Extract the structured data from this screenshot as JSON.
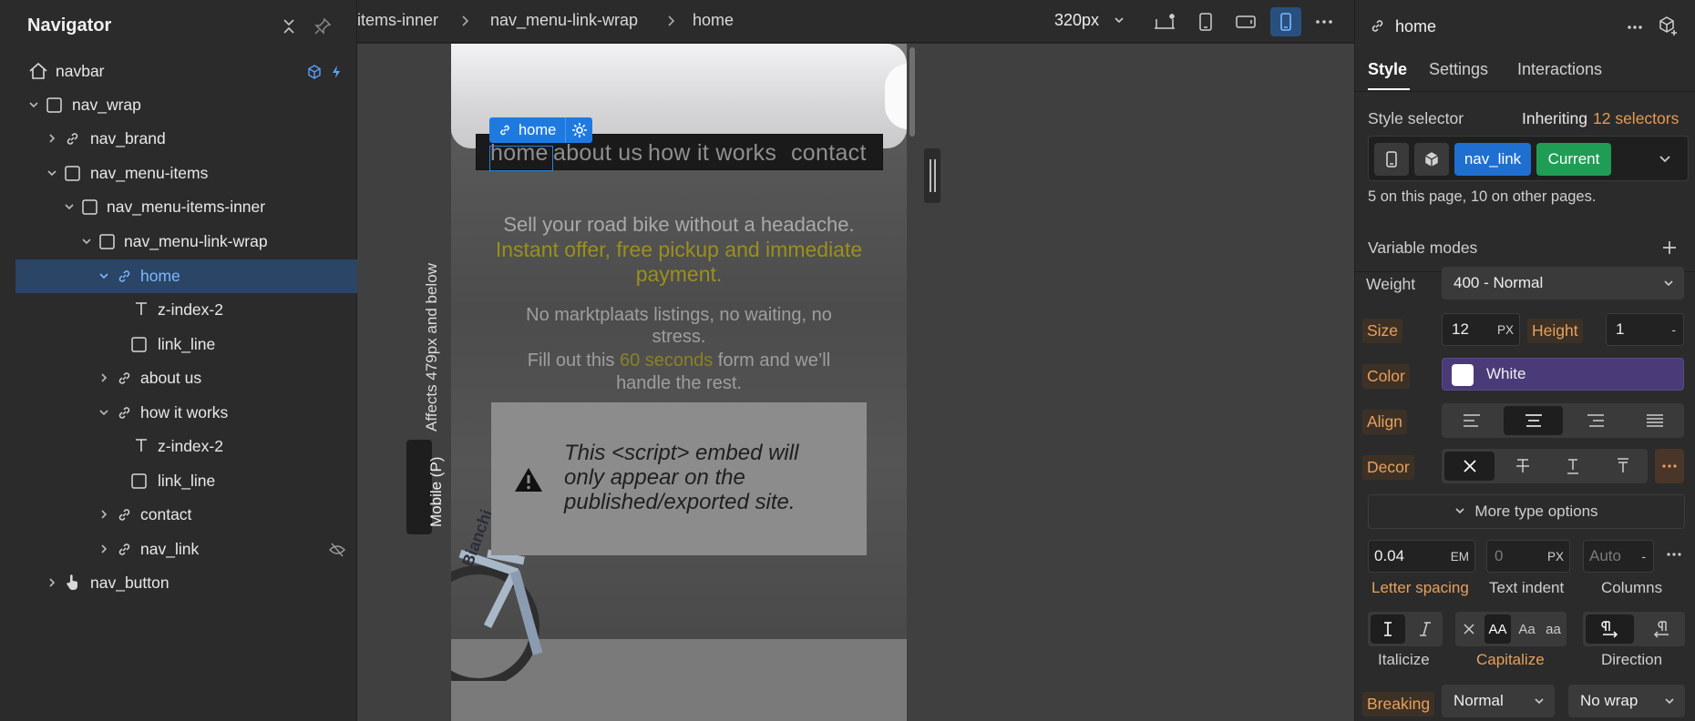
{
  "navigator": {
    "title": "Navigator",
    "tree": [
      {
        "label": "navbar"
      },
      {
        "label": "nav_wrap"
      },
      {
        "label": "nav_brand"
      },
      {
        "label": "nav_menu-items"
      },
      {
        "label": "nav_menu-items-inner"
      },
      {
        "label": "nav_menu-link-wrap"
      },
      {
        "label": "home"
      },
      {
        "label": "z-index-2"
      },
      {
        "label": "link_line"
      },
      {
        "label": "about us"
      },
      {
        "label": "how it works"
      },
      {
        "label": "z-index-2"
      },
      {
        "label": "link_line"
      },
      {
        "label": "contact"
      },
      {
        "label": "nav_link"
      },
      {
        "label": "nav_button"
      }
    ]
  },
  "topbar": {
    "breadcrumbs": [
      "items-inner",
      "nav_menu-link-wrap",
      "home"
    ],
    "breakpoint": "320px"
  },
  "canvas": {
    "breakpoint_note": "Affects 479px and below",
    "breakpoint_badge": "Mobile (P)",
    "selected_tag": "home",
    "nav_links": [
      "home",
      "about us",
      "how it works",
      "contact"
    ],
    "headline": "Sell your road bike without a headache.",
    "headline_accent_1": "Instant offer, free pickup and immediate",
    "headline_accent_2": "payment.",
    "sub_1": "No marktplaats listings, no waiting, no",
    "sub_2": "stress.",
    "sub_3a": "Fill out this ",
    "sub_3b": "60 seconds",
    "sub_3c": " form and we’ll",
    "sub_4": "handle the rest.",
    "embed_text": "This <script> embed will only appear on the published/exported site.",
    "bike_brand": "Bianchi"
  },
  "panel": {
    "element_name": "home",
    "tabs": [
      "Style",
      "Settings",
      "Interactions"
    ],
    "style_selector_label": "Style selector",
    "inheriting_label": "Inheriting",
    "inheriting_count": "12 selectors",
    "selector_class": "nav_link",
    "selector_state": "Current",
    "usage": "5 on this page, 10 on other pages.",
    "variable_modes": "Variable modes",
    "weight_label": "Weight",
    "weight_value": "400 - Normal",
    "size_label": "Size",
    "size_value": "12",
    "size_unit": "PX",
    "height_label": "Height",
    "height_value": "1",
    "height_unit": "-",
    "color_label": "Color",
    "color_value": "White",
    "align_label": "Align",
    "decor_label": "Decor",
    "more_type": "More type options",
    "letter_spacing_value": "0.04",
    "letter_spacing_unit": "EM",
    "letter_spacing_label": "Letter spacing",
    "text_indent_value": "0",
    "text_indent_unit": "PX",
    "text_indent_label": "Text indent",
    "columns_value": "Auto",
    "columns_unit": "-",
    "columns_label": "Columns",
    "italicize_label": "Italicize",
    "capitalize_label": "Capitalize",
    "direction_label": "Direction",
    "cap_options": [
      "AA",
      "Aa",
      "aa"
    ],
    "breaking_label": "Breaking",
    "breaking_value": "Normal",
    "wrap_value": "No wrap"
  },
  "colors": {
    "accent_blue": "#1f7ae0",
    "selected_row": "#2a4566",
    "current_green": "#1f9d55",
    "orange_label": "#e8a05c",
    "color_swatch_bg": "#4a3b78",
    "hero_accent": "#9b8f1c",
    "annotation_arrow": "#9be12a"
  }
}
